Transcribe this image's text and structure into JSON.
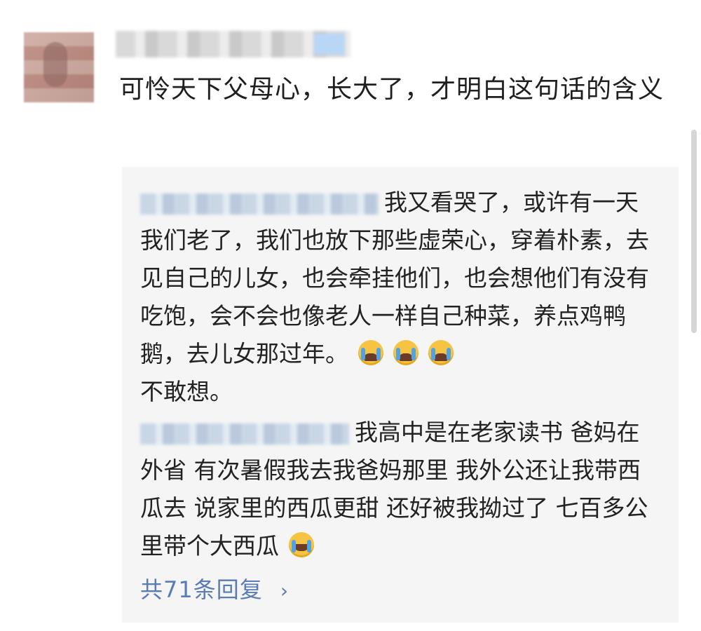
{
  "comment": {
    "text": "可怜天下父母心，长大了，才明白这句话的含义"
  },
  "replies": [
    {
      "text": "我又看哭了，或许有一天我们老了，我们也放下那些虚荣心，穿着朴素，去见自己的儿女，也会牵挂他们，也会想他们有没有吃饱，会不会也像老人一样自己种菜，养点鸡鸭鹅，去儿女那过年。",
      "after_emoji": "不敢想。",
      "emoji": [
        "crying-face-icon",
        "crying-face-icon",
        "crying-face-icon"
      ]
    },
    {
      "text": "我高中是在老家读书 爸妈在外省 有次暑假我去我爸妈那里 我外公还让我带西瓜去 说家里的西瓜更甜 还好被我拗过了 七百多公里带个大西瓜",
      "emoji": [
        "laughing-crying-icon"
      ]
    }
  ],
  "more_replies": {
    "label": "共71条回复",
    "chevron": "›"
  },
  "colors": {
    "link": "#5b7bb3",
    "reply_bg": "#f5f5f5"
  }
}
